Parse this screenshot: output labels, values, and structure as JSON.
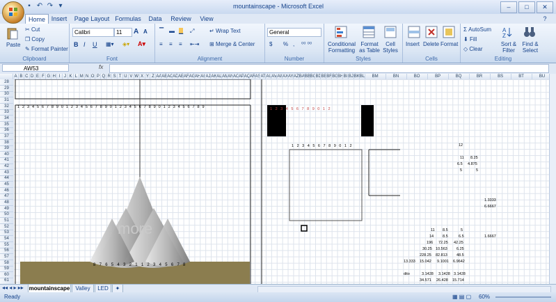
{
  "window": {
    "title": "mountainscape - Microsoft Excel"
  },
  "tabs": [
    "Home",
    "Insert",
    "Page Layout",
    "Formulas",
    "Data",
    "Review",
    "View"
  ],
  "active_tab": "Home",
  "clipboard": {
    "paste": "Paste",
    "cut": "Cut",
    "copy": "Copy",
    "format_painter": "Format Painter",
    "label": "Clipboard"
  },
  "font": {
    "name": "Calibri",
    "size": "11",
    "label": "Font",
    "bold": "B",
    "italic": "I",
    "underline": "U",
    "grow": "A",
    "shrink": "A"
  },
  "alignment": {
    "wrap": "Wrap Text",
    "merge": "Merge & Center",
    "label": "Alignment"
  },
  "number": {
    "format": "General",
    "currency": "$",
    "percent": "%",
    "comma": ",",
    "label": "Number"
  },
  "styles": {
    "conditional": "Conditional Formatting",
    "table": "Format as Table",
    "cell": "Cell Styles",
    "label": "Styles"
  },
  "cells_group": {
    "insert": "Insert",
    "delete": "Delete",
    "format": "Format",
    "label": "Cells"
  },
  "editing": {
    "autosum": "AutoSum",
    "fill": "Fill",
    "clear": "Clear",
    "sort": "Sort & Filter",
    "find": "Find & Select",
    "label": "Editing"
  },
  "namebox": "AW53",
  "fx": "fx",
  "columns": [
    "A",
    "B",
    "C",
    "D",
    "E",
    "F",
    "G",
    "H",
    "I",
    "J",
    "K",
    "L",
    "M",
    "N",
    "O",
    "P",
    "Q",
    "R",
    "S",
    "T",
    "U",
    "V",
    "W",
    "X",
    "Y",
    "Z",
    "AA",
    "AB",
    "AC",
    "AD",
    "AE",
    "AF",
    "AG",
    "AH",
    "AI",
    "AJ",
    "AK",
    "AL",
    "AM",
    "AN",
    "AO",
    "AP",
    "AQ",
    "AR",
    "AS",
    "AT",
    "AU",
    "AV",
    "AW",
    "AX",
    "AY",
    "AZ",
    "BA",
    "BB",
    "BC",
    "BD",
    "BE",
    "BF",
    "BG",
    "BH",
    "BI",
    "BJ",
    "BK",
    "BL",
    "BM",
    "BN",
    "BO",
    "BP",
    "BQ",
    "BR",
    "BS",
    "BT",
    "BU"
  ],
  "rows": [
    "28",
    "29",
    "30",
    "31",
    "32",
    "33",
    "34",
    "35",
    "36",
    "37",
    "38",
    "39",
    "40",
    "41",
    "42",
    "43",
    "44",
    "45",
    "46",
    "47",
    "48",
    "49",
    "50",
    "51",
    "52",
    "53",
    "54",
    "55",
    "56",
    "57",
    "58",
    "59",
    "60",
    "61"
  ],
  "values": {
    "r39": "12",
    "r41a": "11",
    "r41b": "8.25",
    "r42a": "6.5",
    "r42b": "4.875",
    "r43a": "5",
    "r43b": "5",
    "r47": "1.3333",
    "r48": "6.6667",
    "r53a": "11",
    "r53b": "8.5",
    "r53c": "5",
    "r54a": "14",
    "r54b": "8.5",
    "r54c": "6.5",
    "r54d": "1.6667",
    "r55a": "196",
    "r55b": "72.25",
    "r55c": "42.25",
    "r56a": "30.25",
    "r56b": "10.563",
    "r56c": "6.25",
    "r57a": "228.25",
    "r57b": "82.813",
    "r57c": "48.5",
    "r58a": "13.333",
    "r58b": "15.042",
    "r58c": "9.1001",
    "r58d": "6.9642",
    "r60a": "dito",
    "r60b": "3.1428",
    "r60c": "3.1428",
    "r60d": "3.1428",
    "r61a": "34.571",
    "r61b": "26.428",
    "r61c": "15.714"
  },
  "watermark": "more",
  "axis_top": "1 2 3 4 5 6 7 8 9 0 1 2 3 4 5 6 7 8 9 0 1 2 3 4 5 6 7 8 9 0 1 2 3 4 5 6 7 8 9",
  "axis_bottom": "8 7 6 5 4 3 2 1 1 2 3 4 5 6 7 8",
  "axis_mid": "1 2 3 4 5 6 7 8 9 0 1 2",
  "sheets": [
    "mountainscape",
    "Valley",
    "LED"
  ],
  "active_sheet": "mountainscape",
  "status": {
    "ready": "Ready",
    "zoom": "60%"
  },
  "colors": {
    "ground": "#8b7d4f",
    "accent": "#15428b",
    "black_block": "#000000"
  }
}
